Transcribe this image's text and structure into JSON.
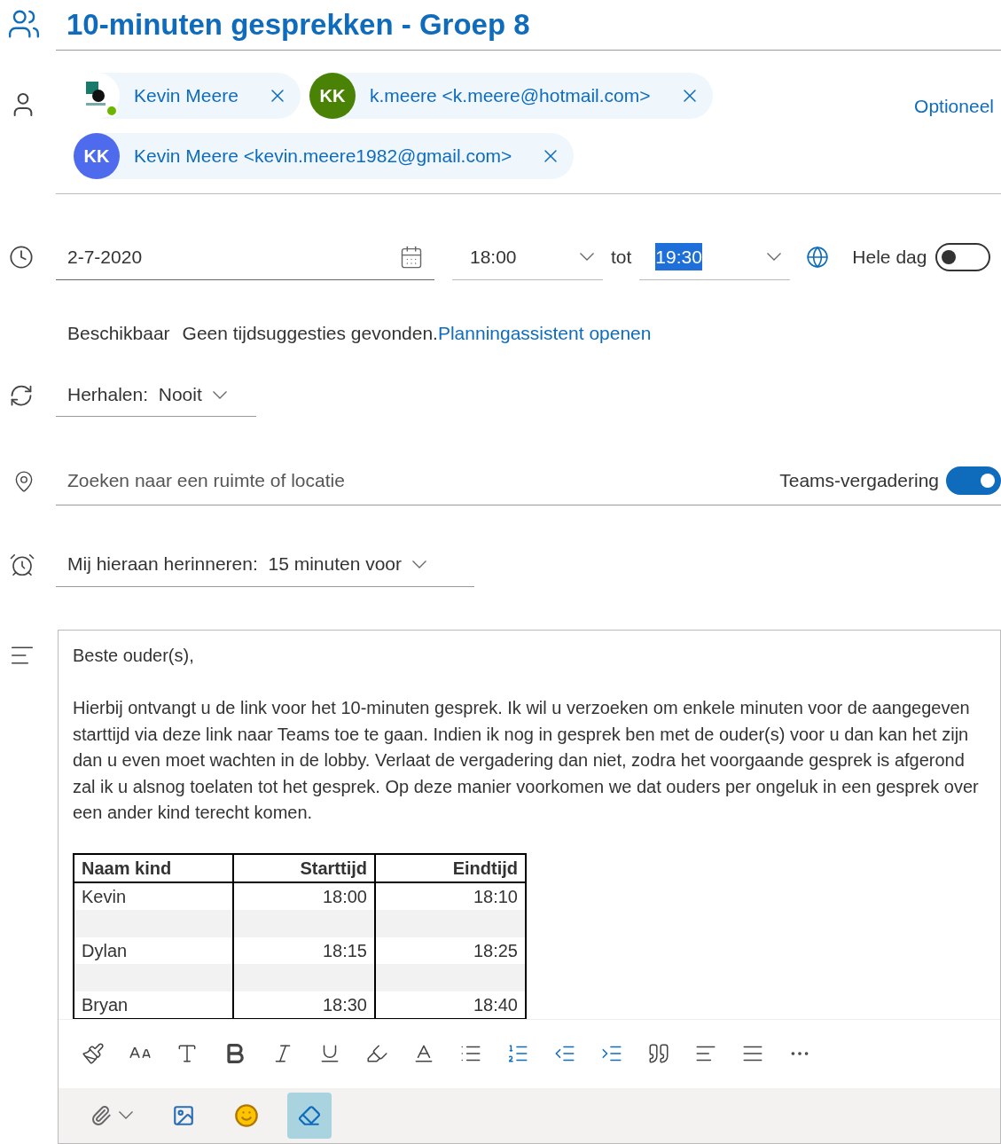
{
  "title": "10-minuten gesprekken - Groep 8",
  "attendees": [
    {
      "kind": "logo",
      "name": "Kevin Meere",
      "online": true
    },
    {
      "kind": "initials",
      "initials": "KK",
      "color": "#498205",
      "name": "k.meere <k.meere@hotmail.com>"
    },
    {
      "kind": "initials",
      "initials": "KK",
      "color": "#4f6bed",
      "name": "Kevin Meere <kevin.meere1982@gmail.com>"
    }
  ],
  "optional_link": "Optioneel",
  "date": "2-7-2020",
  "start_time": "18:00",
  "to_label": "tot",
  "end_time": {
    "value": "19:30",
    "selected": true
  },
  "all_day": {
    "label": "Hele dag",
    "on": false
  },
  "availability": {
    "status": "Beschikbaar",
    "message": "Geen tijdsuggesties gevonden.",
    "link": "Planningassistent openen"
  },
  "repeat": "Herhalen:  Nooit",
  "location": {
    "placeholder": "Zoeken naar een ruimte of locatie"
  },
  "teams": {
    "label": "Teams-vergadering",
    "on": true
  },
  "reminder": "Mij hieraan herinneren:  15 minuten voor",
  "body": {
    "greeting": "Beste ouder(s),",
    "paragraph": "Hierbij ontvangt u de link voor het 10-minuten gesprek. Ik wil u verzoeken om enkele minuten voor de aangegeven starttijd via deze link naar Teams toe te gaan. Indien ik nog in gesprek ben met de ouder(s) voor u dan kan het zijn dan u even moet wachten in de lobby. Verlaat de vergadering dan niet, zodra het voorgaande gesprek is afgerond zal ik u alsnog toelaten tot het gesprek. Op deze manier voorkomen we dat ouders per ongeluk in een gesprek over een ander kind terecht komen.",
    "table": {
      "columns": [
        "Naam kind",
        "Starttijd",
        "Eindtijd"
      ],
      "rows": [
        {
          "kind": "entry",
          "cells": [
            "Kevin",
            "18:00",
            "18:10"
          ]
        },
        {
          "kind": "spacer"
        },
        {
          "kind": "entry",
          "cells": [
            "Dylan",
            "18:15",
            "18:25"
          ]
        },
        {
          "kind": "spacer"
        },
        {
          "kind": "entry",
          "cells": [
            "Bryan",
            "18:30",
            "18:40"
          ]
        }
      ]
    }
  },
  "bottom_tools": [
    {
      "kind": "attach",
      "active": false
    },
    {
      "kind": "image",
      "active": false
    },
    {
      "kind": "emoji",
      "active": false
    },
    {
      "kind": "clear",
      "active": true
    }
  ]
}
